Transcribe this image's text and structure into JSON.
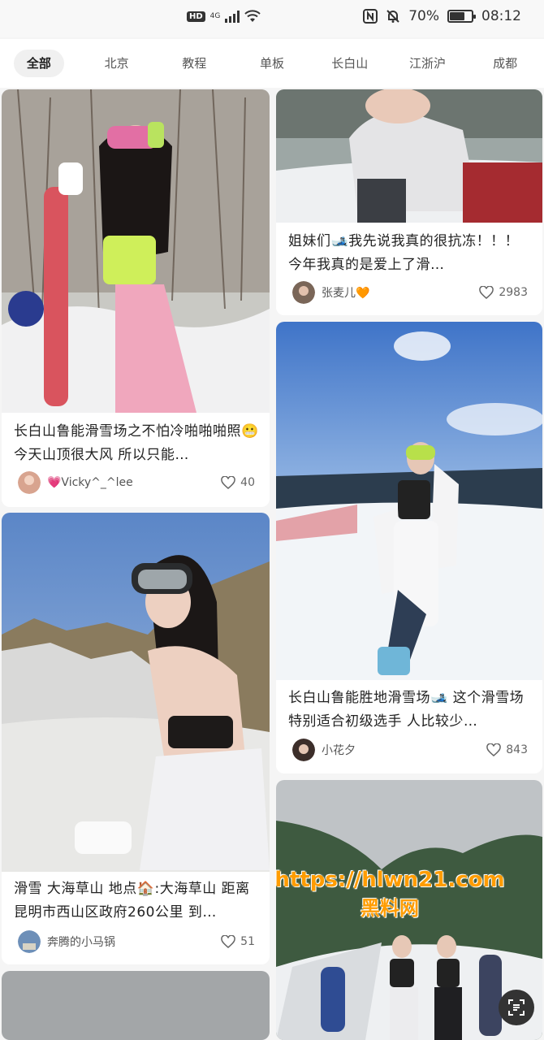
{
  "status_bar": {
    "hd": "HD",
    "network": "4G",
    "battery_text": "70%",
    "battery_level": 0.7,
    "time": "08:12"
  },
  "tabs": [
    {
      "label": "全部",
      "active": true
    },
    {
      "label": "北京",
      "active": false
    },
    {
      "label": "教程",
      "active": false
    },
    {
      "label": "单板",
      "active": false
    },
    {
      "label": "长白山",
      "active": false
    },
    {
      "label": "江浙沪",
      "active": false
    },
    {
      "label": "成都",
      "active": false
    }
  ],
  "feed": {
    "left": [
      {
        "title": "长白山鲁能滑雪场之不怕冷啪啪啪照😬 今天山顶很大风 所以只能…",
        "author": "💗Vicky^_^lee",
        "likes": "40"
      },
      {
        "title": "滑雪 大海草山 地点🏠:大海草山 距离昆明市西山区政府260公里 到…",
        "author": "奔腾的小马锅",
        "likes": "51"
      }
    ],
    "right": [
      {
        "title": "姐妹们🎿我先说我真的很抗冻！！！ 今年我真的是爱上了滑…",
        "author": "张麦儿🧡",
        "likes": "2983"
      },
      {
        "title": "长白山鲁能胜地滑雪场🎿 这个滑雪场特别适合初级选手 人比较少…",
        "author": "小花夕",
        "likes": "843"
      }
    ]
  },
  "watermark": {
    "url": "https://hlwn21.com",
    "name": "黑料网"
  }
}
